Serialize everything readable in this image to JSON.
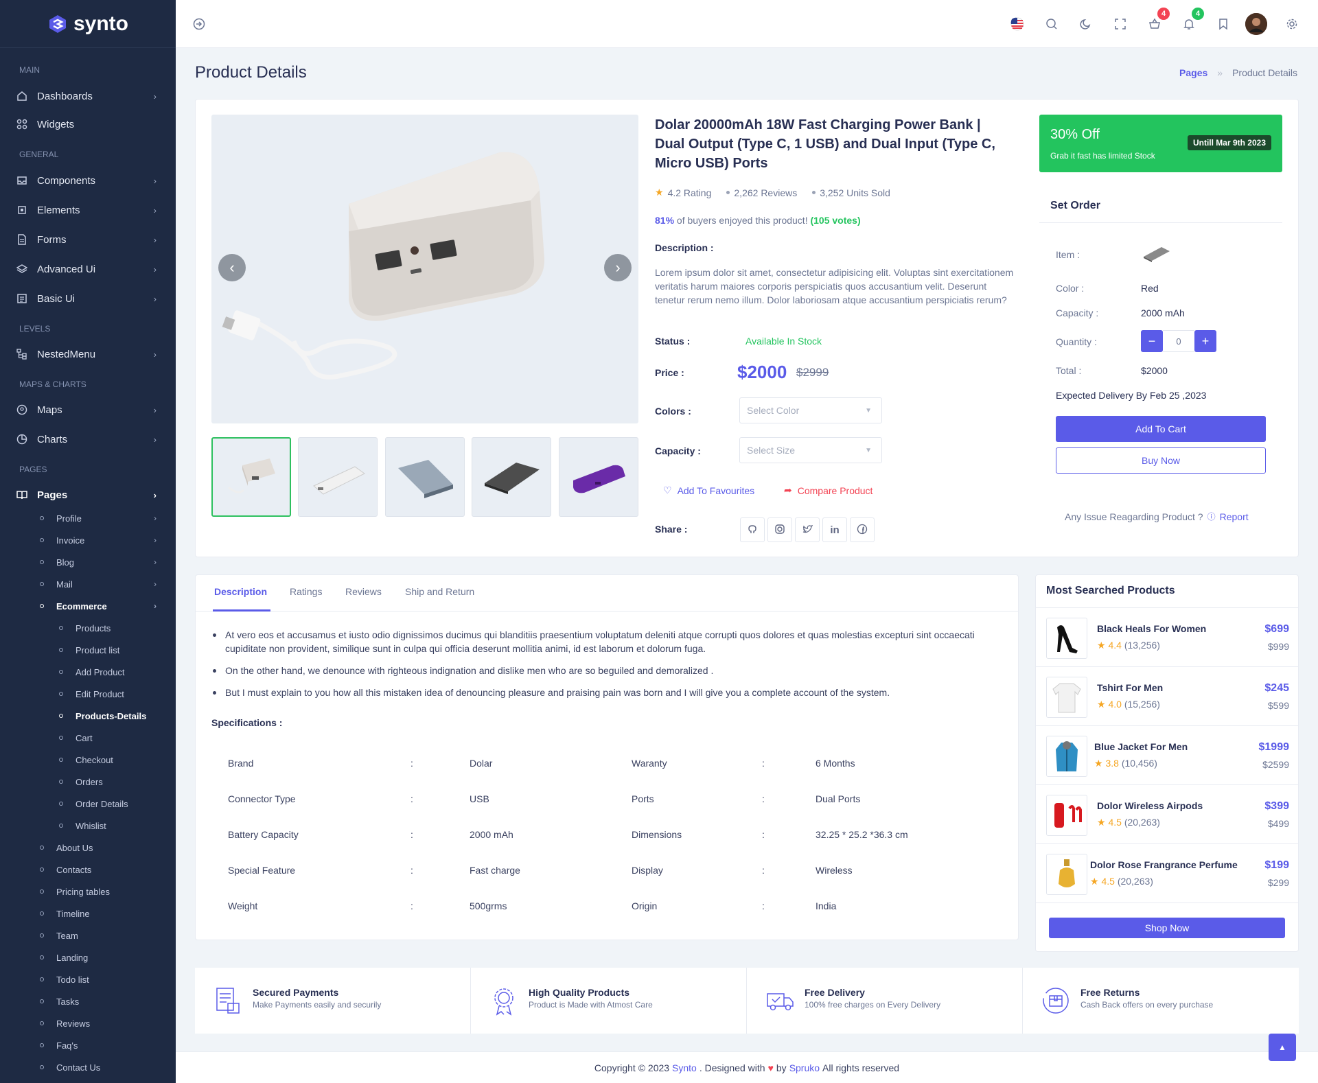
{
  "app": {
    "name": "synto"
  },
  "sidebar": {
    "categories": [
      "MAIN",
      "GENERAL",
      "LEVELS",
      "MAPS & CHARTS",
      "PAGES"
    ],
    "items": [
      {
        "label": "Dashboards",
        "icon": "home-icon"
      },
      {
        "label": "Widgets",
        "icon": "grid-icon"
      },
      {
        "label": "Components",
        "icon": "inbox-icon"
      },
      {
        "label": "Elements",
        "icon": "cpu-icon"
      },
      {
        "label": "Forms",
        "icon": "file-icon"
      },
      {
        "label": "Advanced Ui",
        "icon": "layers-icon"
      },
      {
        "label": "Basic Ui",
        "icon": "page-icon"
      },
      {
        "label": "NestedMenu",
        "icon": "tree-icon"
      },
      {
        "label": "Maps",
        "icon": "map-pin-icon"
      },
      {
        "label": "Charts",
        "icon": "pie-chart-icon"
      },
      {
        "label": "Pages",
        "icon": "book-icon"
      }
    ],
    "pages_sub": [
      "Profile",
      "Invoice",
      "Blog",
      "Mail",
      "Ecommerce"
    ],
    "ecommerce_sub": [
      "Products",
      "Product list",
      "Add Product",
      "Edit Product",
      "Products-Details",
      "Cart",
      "Checkout",
      "Orders",
      "Order Details",
      "Whislist"
    ],
    "pages_more": [
      "About Us",
      "Contacts",
      "Pricing tables",
      "Timeline",
      "Team",
      "Landing",
      "Todo list",
      "Tasks",
      "Reviews",
      "Faq's",
      "Contact Us"
    ]
  },
  "header": {
    "cart_badge": "4",
    "notif_badge": "4"
  },
  "page": {
    "title": "Product Details",
    "breadcrumb": [
      "Pages",
      "Product Details"
    ]
  },
  "product": {
    "title": "Dolar 20000mAh 18W Fast Charging Power Bank | Dual Output (Type C, 1 USB) and Dual Input (Type C, Micro USB) Ports",
    "rating": "4.2 Rating",
    "reviews": "2,262 Reviews",
    "sold": "3,252 Units Sold",
    "buyers_pct": "81%",
    "buyers_text": "of buyers enjoyed this product!",
    "votes": "(105 votes)",
    "desc_label": "Description :",
    "description": "Lorem ipsum dolor sit amet, consectetur adipisicing elit. Voluptas sint exercitationem veritatis harum maiores corporis perspiciatis quos accusantium velit. Deserunt tenetur rerum nemo illum. Dolor laboriosam atque accusantium perspiciatis rerum?",
    "status_label": "Status :",
    "status": "Available In Stock",
    "price_label": "Price :",
    "price": "$2000",
    "old_price": "$2999",
    "colors_label": "Colors :",
    "colors_placeholder": "Select Color",
    "capacity_label": "Capacity :",
    "capacity_placeholder": "Select Size",
    "fav": "Add To Favourites",
    "compare": "Compare Product",
    "share_label": "Share :"
  },
  "offer": {
    "title": "30% Off",
    "sub": "Grab it fast has limited Stock",
    "until": "Untill Mar 9th 2023"
  },
  "set_order": {
    "title": "Set Order",
    "item_label": "Item :",
    "color_label": "Color :",
    "color": "Red",
    "capacity_label": "Capacity :",
    "capacity": "2000 mAh",
    "quantity_label": "Quantity :",
    "quantity": "0",
    "total_label": "Total :",
    "total": "$2000",
    "delivery": "Expected Delivery By Feb 25 ,2023",
    "add_cart": "Add To Cart",
    "buy_now": "Buy Now",
    "issue": "Any Issue Reagarding Product ?",
    "report": "Report"
  },
  "tabs": [
    "Description",
    "Ratings",
    "Reviews",
    "Ship and Return"
  ],
  "details": {
    "bullets": [
      "At vero eos et accusamus et iusto odio dignissimos ducimus qui blanditiis praesentium voluptatum deleniti atque corrupti quos dolores et quas molestias excepturi sint occaecati cupiditate non provident, similique sunt in culpa qui officia deserunt mollitia animi, id est laborum et dolorum fuga.",
      "On the other hand, we denounce with righteous indignation and dislike men who are so beguiled and demoralized .",
      "But I must explain to you how all this mistaken idea of denouncing pleasure and praising pain was born and I will give you a complete account of the system."
    ],
    "spec_title": "Specifications :",
    "specs": [
      [
        "Brand",
        "Dolar",
        "Waranty",
        "6 Months"
      ],
      [
        "Connector Type",
        "USB",
        "Ports",
        "Dual Ports"
      ],
      [
        "Battery Capacity",
        "2000 mAh",
        "Dimensions",
        "32.25 * 25.2 *36.3 cm"
      ],
      [
        "Special Feature",
        "Fast charge",
        "Display",
        "Wireless"
      ],
      [
        "Weight",
        "500grms",
        "Origin",
        "India"
      ]
    ]
  },
  "most_searched": {
    "title": "Most Searched Products",
    "items": [
      {
        "name": "Black Heals For Women",
        "rating": "4.4",
        "count": "(13,256)",
        "price": "$699",
        "old": "$999"
      },
      {
        "name": "Tshirt For Men",
        "rating": "4.0",
        "count": "(15,256)",
        "price": "$245",
        "old": "$599"
      },
      {
        "name": "Blue Jacket For Men",
        "rating": "3.8",
        "count": "(10,456)",
        "price": "$1999",
        "old": "$2599"
      },
      {
        "name": "Dolor Wireless Airpods",
        "rating": "4.5",
        "count": "(20,263)",
        "price": "$399",
        "old": "$499"
      },
      {
        "name": "Dolor Rose Frangrance Perfume",
        "rating": "4.5",
        "count": "(20,263)",
        "price": "$199",
        "old": "$299"
      }
    ],
    "shop_now": "Shop Now"
  },
  "features": [
    {
      "title": "Secured Payments",
      "sub": "Make Payments easily and securily"
    },
    {
      "title": "High Quality Products",
      "sub": "Product is Made with Atmost Care"
    },
    {
      "title": "Free Delivery",
      "sub": "100% free charges on Every Delivery"
    },
    {
      "title": "Free Returns",
      "sub": "Cash Back offers on every purchase"
    }
  ],
  "footer": {
    "pre": "Copyright © 2023",
    "brand": "Synto",
    "mid": ". Designed with",
    "by": "by",
    "company": "Spruko",
    "post": "All rights reserved"
  },
  "colors": {
    "primary": "#5a5be8",
    "success": "#23c45e",
    "sidebar": "#1e2a43",
    "danger": "#f34353"
  }
}
